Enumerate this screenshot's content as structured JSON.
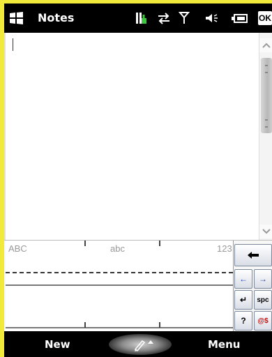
{
  "titlebar": {
    "app_title": "Notes",
    "ok_label": "OK",
    "icons": [
      "windows-start-icon",
      "connectivity-icon",
      "data-sync-icon",
      "signal-icon",
      "volume-icon",
      "battery-icon"
    ]
  },
  "note": {
    "text": ""
  },
  "input_panel": {
    "zones": {
      "upper": "ABC",
      "lower": "abc",
      "numbers": "123"
    },
    "keys": {
      "backspace": "←",
      "left": "←",
      "right": "→",
      "enter": "↵",
      "space": "spc",
      "help": "?",
      "symbols": "@$"
    }
  },
  "softkeys": {
    "left": "New",
    "right": "Menu"
  },
  "colors": {
    "screen_border": "#f2ea3a",
    "bar_background": "#000000",
    "accent_green": "#3cc83c"
  }
}
